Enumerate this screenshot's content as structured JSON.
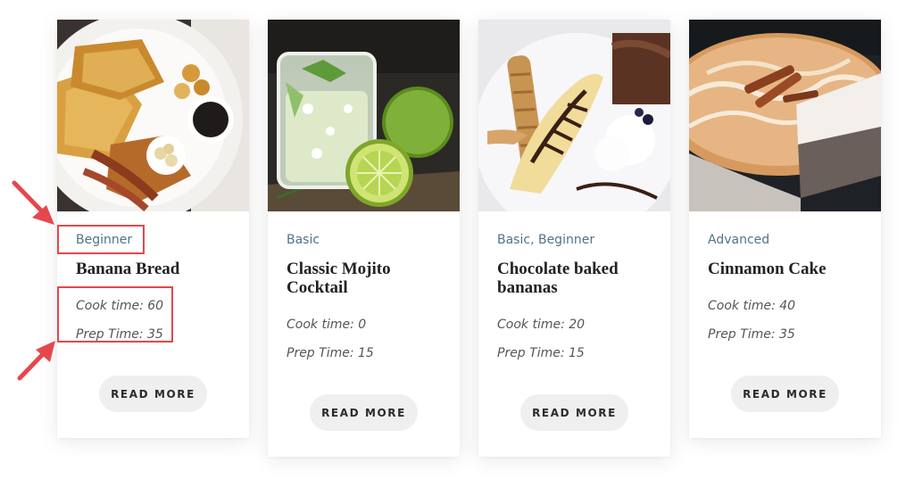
{
  "cards": [
    {
      "category": "Beginner",
      "title": "Banana Bread",
      "cook_time": "Cook time: 60",
      "prep_time": "Prep Time: 35",
      "button": "READ MORE",
      "image": "french-toast-breakfast-photo"
    },
    {
      "category": "Basic",
      "title": "Classic Mojito Cocktail",
      "cook_time": "Cook time: 0",
      "prep_time": "Prep Time: 15",
      "button": "READ MORE",
      "image": "mojito-glass-photo"
    },
    {
      "category": "Basic, Beginner",
      "title": "Chocolate baked bananas",
      "cook_time": "Cook time: 20",
      "prep_time": "Prep Time: 15",
      "button": "READ MORE",
      "image": "banana-dessert-photo"
    },
    {
      "category": "Advanced",
      "title": "Cinnamon Cake",
      "cook_time": "Cook time: 40",
      "prep_time": "Prep Time: 35",
      "button": "READ MORE",
      "image": "cinnamon-cake-photo"
    }
  ],
  "annotation_color": "#e5474d",
  "category_color": "#4e7487"
}
